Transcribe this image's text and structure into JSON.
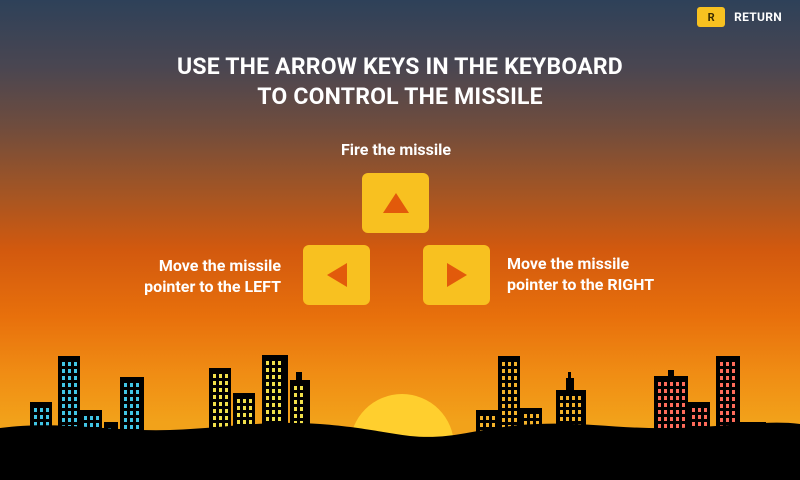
{
  "return_button": {
    "key": "R",
    "label": "RETURN"
  },
  "headline": {
    "line1": "USE THE ARROW KEYS IN THE KEYBOARD",
    "line2": "TO CONTROL THE MISSILE"
  },
  "controls": {
    "up": {
      "caption": "Fire the missile"
    },
    "left": {
      "caption_line1": "Move the missile",
      "caption_line2": "pointer to the LEFT"
    },
    "right": {
      "caption_line1": "Move the missile",
      "caption_line2": "pointer to the RIGHT"
    }
  },
  "colors": {
    "key_fill": "#f8c120",
    "arrow_fill": "#e25a0b",
    "silhouette": "#000000",
    "sun": "#ffcf2e"
  }
}
